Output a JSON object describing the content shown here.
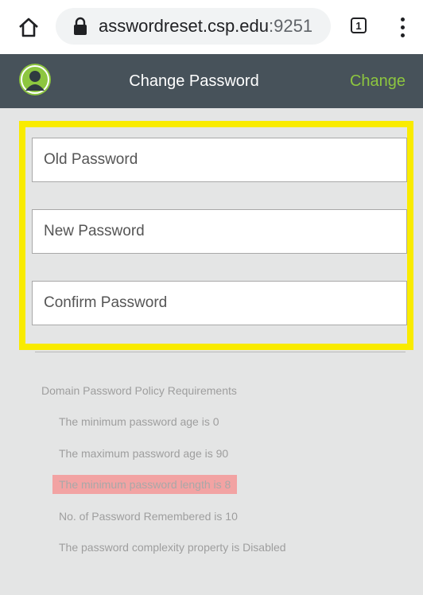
{
  "browser": {
    "url_host": "asswordreset.csp.edu",
    "url_port": ":9251",
    "tab_count": "1"
  },
  "header": {
    "title": "Change Password",
    "action_label": "Change",
    "accent_color": "#8dc63f",
    "bg_color": "#47525a"
  },
  "form": {
    "old_password": {
      "placeholder": "Old Password",
      "value": ""
    },
    "new_password": {
      "placeholder": "New Password",
      "value": ""
    },
    "confirm_password": {
      "placeholder": "Confirm Password",
      "value": ""
    },
    "highlight_color": "#f9eb00"
  },
  "policy": {
    "heading": "Domain Password Policy Requirements",
    "items": [
      "The minimum password age is 0",
      "The maximum password age is 90",
      "The minimum password length is 8",
      "No. of Password Remembered is 10",
      "The password complexity property is Disabled"
    ],
    "highlight_color": "#f2a3a3"
  }
}
